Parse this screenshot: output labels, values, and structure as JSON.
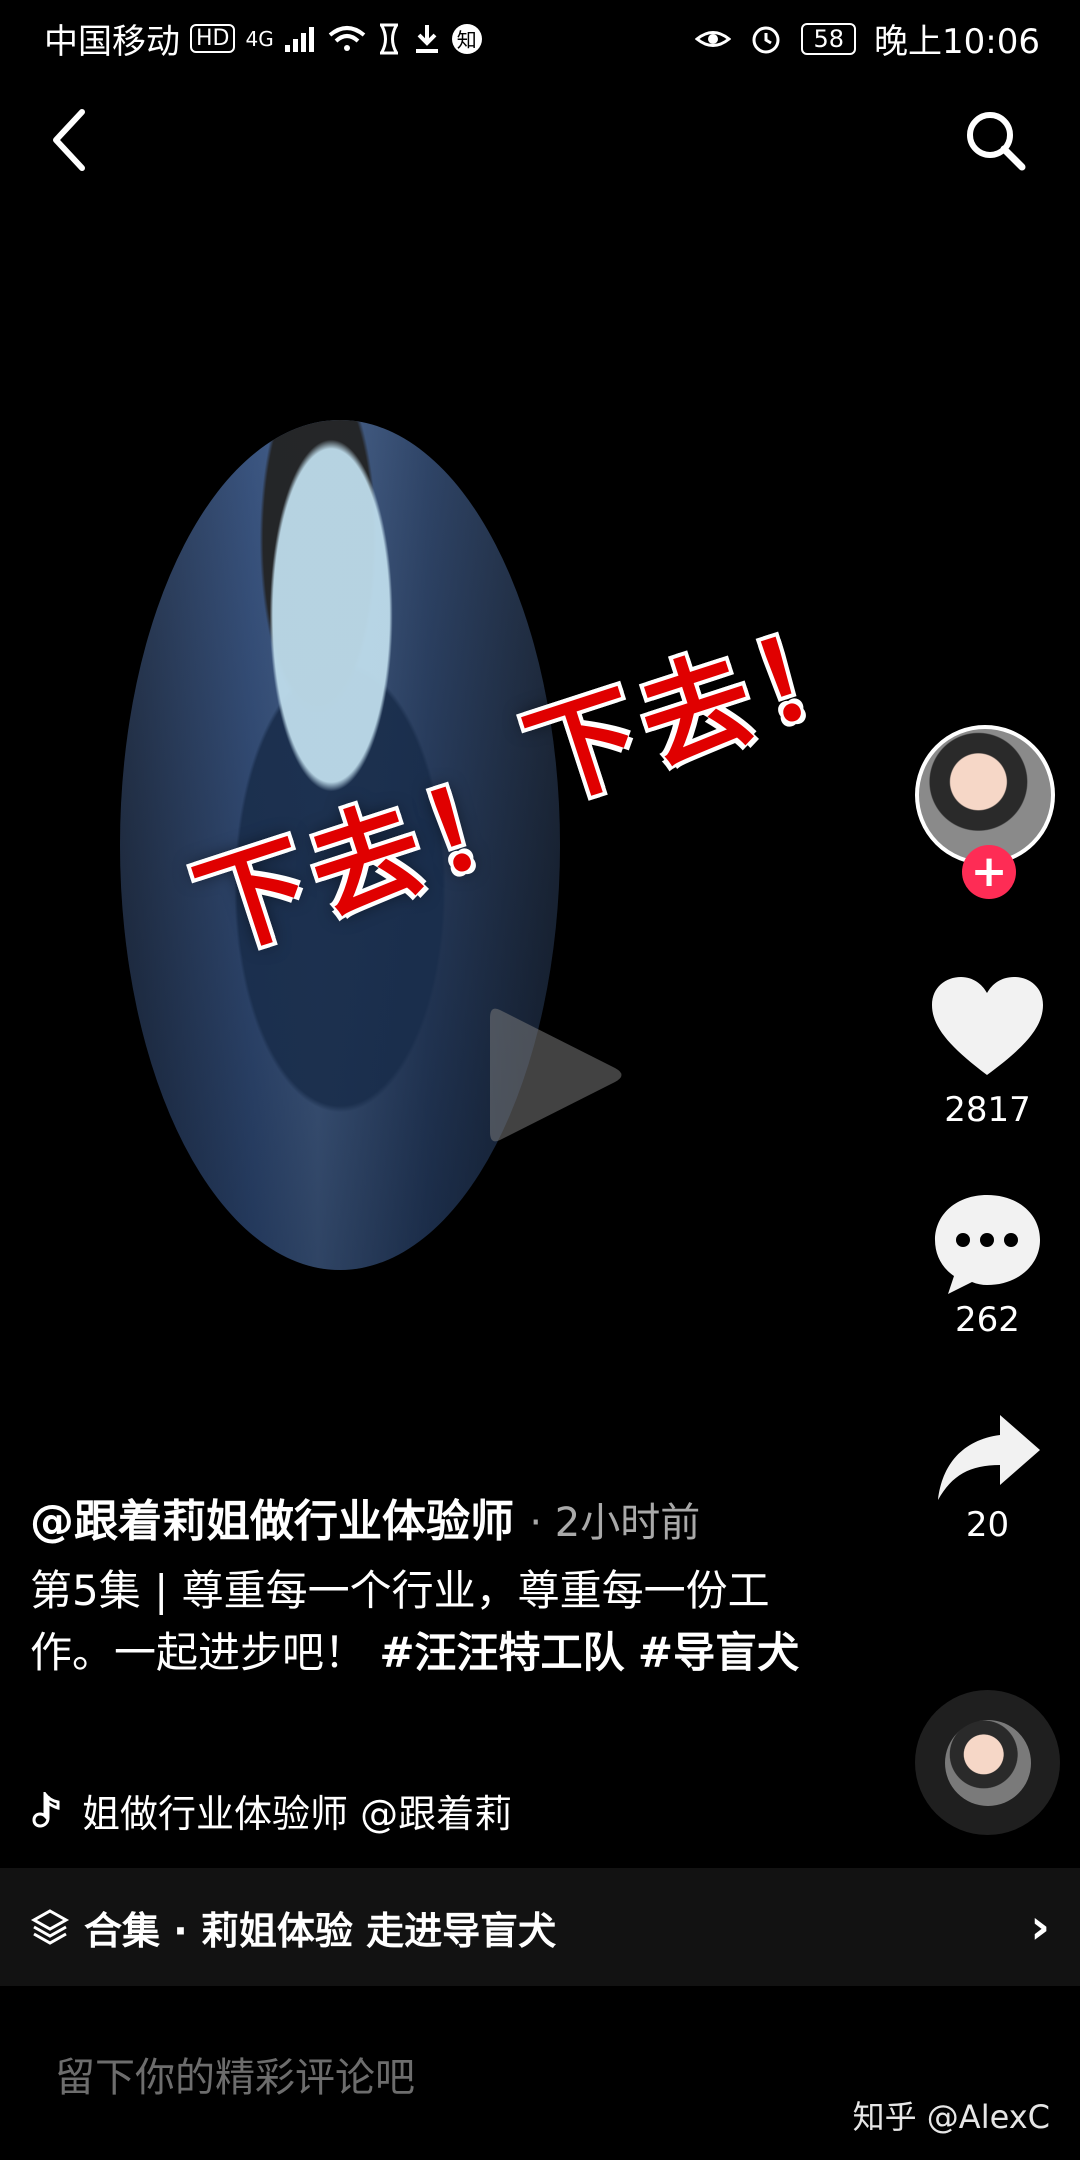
{
  "status_bar": {
    "carrier": "中国移动",
    "hd_badge": "HD",
    "network": "4G",
    "zhihu_badge": "知",
    "battery": "58",
    "time": "晚上10:06",
    "icons": [
      "signal-icon",
      "wifi-icon",
      "hourglass-icon",
      "download-icon",
      "eye-icon",
      "alarm-icon",
      "battery-icon"
    ]
  },
  "top_bar": {
    "back_icon": "back-icon",
    "search_icon": "search-icon"
  },
  "video": {
    "overlay_text_1": "下去！",
    "overlay_text_2": "下去！",
    "play_icon": "play-icon"
  },
  "right_rail": {
    "avatar_icon": "avatar-icon",
    "follow_symbol": "+",
    "like_count": "2817",
    "comment_count": "262",
    "share_count": "20"
  },
  "caption": {
    "username": "@跟着莉姐做行业体验师",
    "time": " · 2小时前",
    "text": "第5集 | 尊重每一个行业，尊重每一份工作。一起进步吧！ ",
    "hashtag_1": "#汪汪特工队",
    "hashtag_2": " #导盲犬",
    "music_icon": "music-note-icon",
    "music_text": "姐做行业体验师    @跟着莉"
  },
  "collection": {
    "icon": "layers-icon",
    "label": "合集 · 莉姐体验 走进导盲犬",
    "arrow": "›"
  },
  "comment_input": {
    "placeholder": "留下你的精彩评论吧"
  },
  "watermark": "知乎 @AlexC",
  "colors": {
    "background": "#000000",
    "accent": "#fe2c55",
    "secondary_text": "#a9a9a9",
    "input_text": "#6d6d6d"
  }
}
